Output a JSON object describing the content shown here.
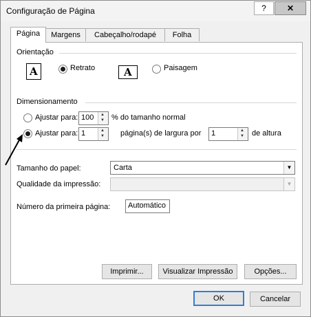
{
  "window": {
    "title": "Configuração de Página",
    "help_label": "?",
    "close_label": "✕"
  },
  "tabs": [
    {
      "label": "Página",
      "active": true
    },
    {
      "label": "Margens"
    },
    {
      "label": "Cabeçalho/rodapé"
    },
    {
      "label": "Folha"
    }
  ],
  "orientation": {
    "label": "Orientação",
    "portrait_label": "Retrato",
    "landscape_label": "Paisagem",
    "portrait_selected": true,
    "icon_glyph": "A"
  },
  "scaling": {
    "label": "Dimensionamento",
    "adjust_percent_label": "Ajustar para:",
    "percent_value": "100",
    "percent_suffix": "% do tamanho normal",
    "fit_label": "Ajustar para:",
    "pages_wide_value": "1",
    "pages_wide_suffix": "página(s) de largura por",
    "pages_tall_value": "1",
    "pages_tall_suffix": "de altura",
    "fit_selected": true
  },
  "paper": {
    "label": "Tamanho do papel:",
    "value": "Carta"
  },
  "quality": {
    "label": "Qualidade da impressão:",
    "value": ""
  },
  "first_page": {
    "label": "Número da primeira página:",
    "value": "Automático"
  },
  "buttons": {
    "print": "Imprimir...",
    "preview": "Visualizar Impressão",
    "options": "Opções...",
    "ok": "OK",
    "cancel": "Cancelar"
  }
}
